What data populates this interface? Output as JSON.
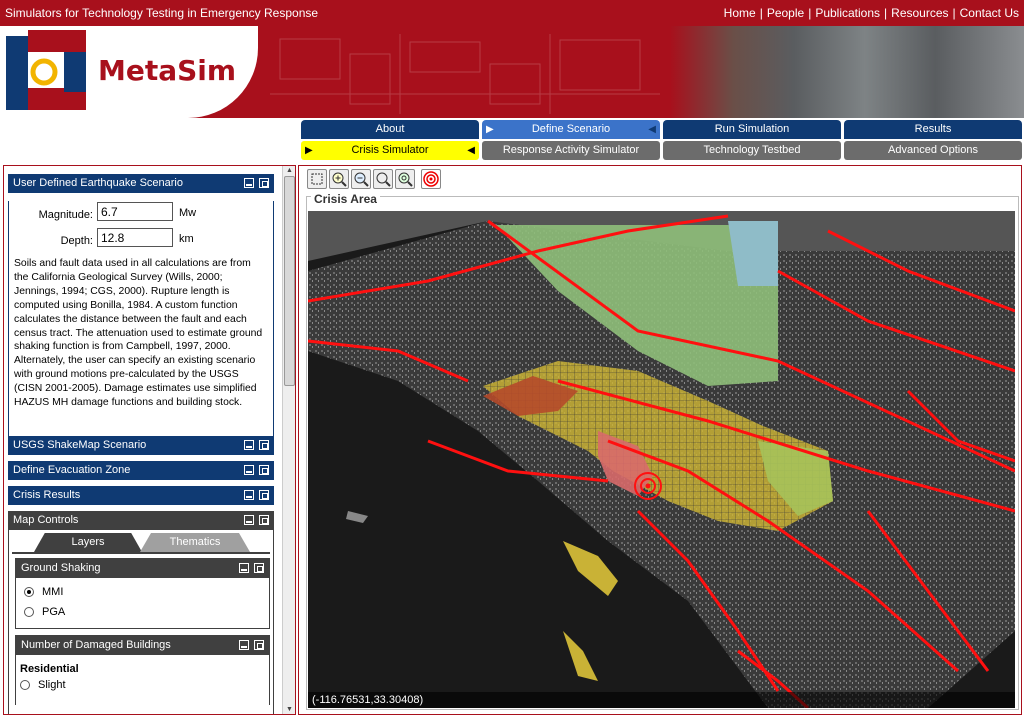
{
  "topbar": {
    "tagline": "Simulators for Technology Testing in Emergency Response",
    "links": [
      "Home",
      "People",
      "Publications",
      "Resources",
      "Contact Us"
    ]
  },
  "brand": {
    "name": "MetaSim"
  },
  "nav": {
    "row1": [
      "About",
      "Define Scenario",
      "Run Simulation",
      "Results"
    ],
    "row2": [
      "Crisis Simulator",
      "Response Activity Simulator",
      "Technology Testbed",
      "Advanced Options"
    ]
  },
  "left": {
    "earthquake": {
      "title": "User Defined Earthquake Scenario",
      "magnitude_label": "Magnitude:",
      "magnitude_value": "6.7",
      "magnitude_unit": "Mw",
      "depth_label": "Depth:",
      "depth_value": "12.8",
      "depth_unit": "km",
      "description": "Soils and fault data used in all calculations are from the California Geological Survey (Wills, 2000; Jennings, 1994; CGS, 2000). Rupture length is computed using Bonilla, 1984. A custom function calculates the distance between the fault and each census tract. The attenuation used to estimate ground shaking function is from Campbell, 1997, 2000. Alternately, the user can specify an existing scenario with ground motions pre-calculated by the USGS (CISN 2001-2005). Damage estimates use simplified HAZUS MH damage functions and building stock."
    },
    "shakemap": {
      "title": "USGS ShakeMap Scenario"
    },
    "evacuation": {
      "title": "Define Evacuation Zone"
    },
    "results": {
      "title": "Crisis Results"
    },
    "mapcontrols": {
      "title": "Map Controls",
      "tabs": [
        "Layers",
        "Thematics"
      ],
      "ground_shaking": {
        "title": "Ground Shaking",
        "options": [
          "MMI",
          "PGA"
        ],
        "selected": "MMI"
      },
      "damaged": {
        "title": "Number of Damaged Buildings",
        "subheading": "Residential",
        "first_option": "Slight"
      }
    }
  },
  "main": {
    "area_title": "Crisis Area",
    "coordinates": "(-116.76531,33.30408)",
    "tools": [
      "select-tool-icon",
      "zoom-in-icon",
      "zoom-out-icon",
      "zoom-previous-icon",
      "zoom-extent-icon",
      "epicenter-icon"
    ]
  },
  "colors": {
    "brand_red": "#a8101c",
    "nav_blue": "#0f3a73",
    "active_blue": "#3b73c9",
    "highlight_yellow": "#ffff00",
    "fault_red": "#ff1010"
  }
}
